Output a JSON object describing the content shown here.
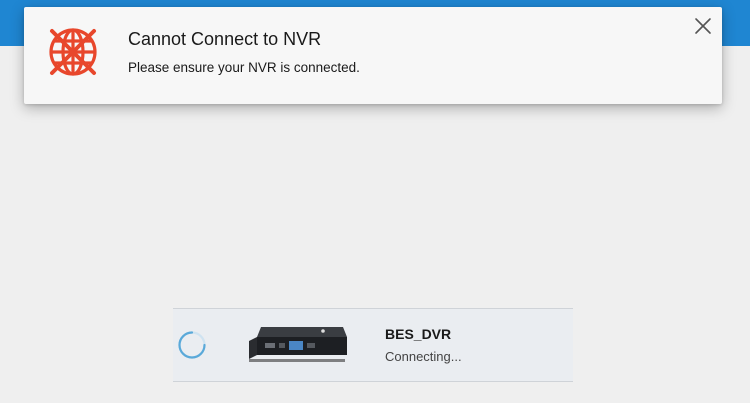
{
  "header": {
    "color": "#1f86d2"
  },
  "toast": {
    "icon": "globe-crossed-icon",
    "icon_color": "#e8472c",
    "title": "Cannot Connect to NVR",
    "message": "Please ensure your NVR is connected.",
    "close_icon": "close-icon"
  },
  "device": {
    "name": "BES_DVR",
    "status": "Connecting...",
    "spinner_icon": "loading-spinner-icon",
    "spinner_color": "#5aa9d9"
  }
}
